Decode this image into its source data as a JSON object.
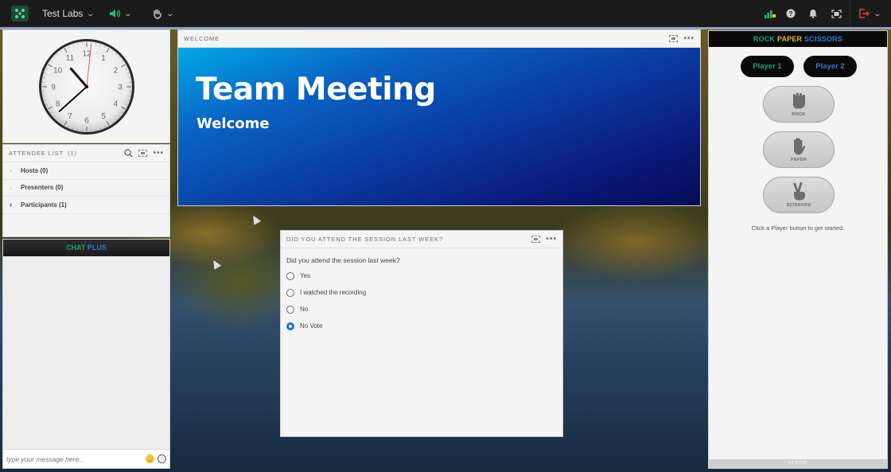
{
  "topbar": {
    "app_icon": "adobe-connect-logo-icon",
    "room_name": "Test Labs",
    "audio_icon": "speaker-icon",
    "hand_icon": "raise-hand-icon",
    "right_icons": [
      "signal-strength-icon",
      "help-icon",
      "bell-icon",
      "fullscreen-icon",
      "exit-icon"
    ]
  },
  "clock": {
    "hour": 10,
    "minute": 38,
    "second": 1,
    "numbers": [
      "12",
      "1",
      "2",
      "3",
      "4",
      "5",
      "6",
      "7",
      "8",
      "9",
      "10",
      "11"
    ]
  },
  "attendees": {
    "title": "ATTENDEE LIST",
    "count": "(1)",
    "groups": [
      {
        "label": "Hosts (0)",
        "expandable": false
      },
      {
        "label": "Presenters (0)",
        "expandable": false
      },
      {
        "label": "Participants (1)",
        "expandable": true
      }
    ]
  },
  "chat": {
    "title_part1": "CHAT",
    "title_part2": "PLUS",
    "input_placeholder": "type your message here...",
    "emoji_icon": "emoji-icon",
    "send_icon": "send-icon"
  },
  "welcome": {
    "header": "WELCOME",
    "title": "Team Meeting",
    "subtitle": "Welcome"
  },
  "poll": {
    "header": "DID YOU ATTEND THE SESSION LAST WEEK?",
    "question": "Did you attend the session last week?",
    "options": [
      {
        "label": "Yes",
        "selected": false
      },
      {
        "label": "I watched the recording",
        "selected": false
      },
      {
        "label": "No",
        "selected": false
      },
      {
        "label": "No Vote",
        "selected": true
      }
    ]
  },
  "rps": {
    "title_rock": "ROCK",
    "title_paper": "PAPER",
    "title_scissors": "SCISSORS",
    "player1": "Player 1",
    "player2": "Player 2",
    "choices": [
      "ROCK",
      "PAPER",
      "SCISSORS"
    ],
    "hint": "Click a Player button to get started.",
    "version": "v1.5.016"
  },
  "colors": {
    "accent_green": "#1fa37a",
    "accent_blue": "#2f7ad8",
    "accent_yellow": "#e8b820",
    "radio_selected": "#1e6fd9"
  }
}
